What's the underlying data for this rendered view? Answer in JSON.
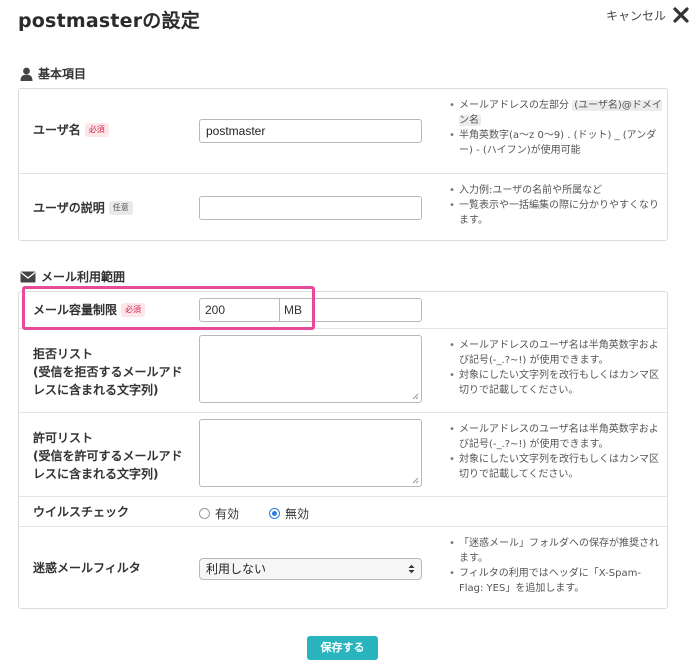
{
  "page": {
    "title": "postmasterの設定",
    "cancel_label": "キャンセル",
    "save_label": "保存する"
  },
  "sections": {
    "basic": {
      "title": "基本項目",
      "icon": "user-icon"
    },
    "mail": {
      "title": "メール利用範囲",
      "icon": "envelope-icon"
    }
  },
  "badges": {
    "required": "必須",
    "optional": "任意"
  },
  "username": {
    "label": "ユーザ名",
    "value": "postmaster",
    "help_1_a": "メールアドレスの左部分",
    "help_1_chip": "(ユーザ名)@ドメイン名",
    "help_2": "半角英数字(a〜z 0〜9) . (ドット) _ (アンダー) - (ハイフン)が使用可能"
  },
  "description": {
    "label": "ユーザの説明",
    "value": "",
    "help_1": "入力例:ユーザの名前や所属など",
    "help_2": "一覧表示や一括編集の際に分かりやすくなります。"
  },
  "capacity": {
    "label": "メール容量制限",
    "value": "200",
    "unit": "MB"
  },
  "reject_list": {
    "label_line1": "拒否リスト",
    "label_line2": "(受信を拒否するメールアド",
    "label_line3": "レスに含まれる文字列)",
    "value": "",
    "help_1": "メールアドレスのユーザ名は半角英数字および記号(-_.?~!) が使用できます。",
    "help_2": "対象にしたい文字列を改行もしくはカンマ区切りで記載してください。"
  },
  "allow_list": {
    "label_line1": "許可リスト",
    "label_line2": "(受信を許可するメールアド",
    "label_line3": "レスに含まれる文字列)",
    "value": "",
    "help_1": "メールアドレスのユーザ名は半角英数字および記号(-_.?~!) が使用できます。",
    "help_2": "対象にしたい文字列を改行もしくはカンマ区切りで記載してください。"
  },
  "virus_check": {
    "label": "ウイルスチェック",
    "options": [
      "有効",
      "無効"
    ],
    "selected": "無効"
  },
  "spam_filter": {
    "label": "迷惑メールフィルタ",
    "selected": "利用しない",
    "help_1": "「迷惑メール」フォルダへの保存が推奨されます。",
    "help_2": "フィルタの利用ではヘッダに「X-Spam-Flag: YES」を追加します。"
  },
  "colors": {
    "accent": "#29b4be",
    "highlight": "#e8499a",
    "required_badge": "#d6244b",
    "radio_selected": "#2a7de1"
  }
}
